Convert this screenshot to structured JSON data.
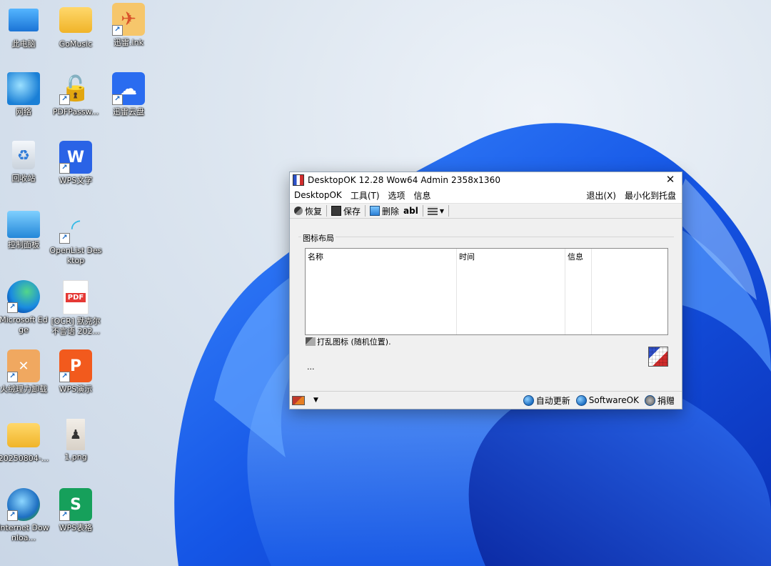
{
  "desktop": {
    "icons": [
      {
        "label": "此电脑",
        "name": "this-pc"
      },
      {
        "label": "GoMusic",
        "name": "gomusic"
      },
      {
        "label": "迅雷.lnk",
        "name": "xunlei-lnk"
      },
      {
        "label": "网络",
        "name": "network"
      },
      {
        "label": "PDFPassw...",
        "name": "pdfpassword"
      },
      {
        "label": "迅雷云盘",
        "name": "xunlei-cloud"
      },
      {
        "label": "回收站",
        "name": "recycle-bin"
      },
      {
        "label": "WPS文字",
        "name": "wps-writer"
      },
      {
        "label": "控制面板",
        "name": "control-panel"
      },
      {
        "label": "OpenList Desktop",
        "name": "openlist-desktop"
      },
      {
        "label": "Microsoft Edge",
        "name": "microsoft-edge"
      },
      {
        "label": "[OCR] 默克尔 不言语 202...",
        "name": "ocr-pdf"
      },
      {
        "label": "火绒理力卸载",
        "name": "uninstaller"
      },
      {
        "label": "WPS演示",
        "name": "wps-presentation"
      },
      {
        "label": "20250804-...",
        "name": "folder-20250804"
      },
      {
        "label": "1.png",
        "name": "png-file"
      },
      {
        "label": "Internet Downloa...",
        "name": "internet-download"
      },
      {
        "label": "WPS表格",
        "name": "wps-spreadsheet"
      }
    ]
  },
  "window": {
    "title": "DesktopOK 12.28   Wow64   Admin 2358x1360",
    "close": "✕",
    "menu": {
      "left": [
        "DesktopOK",
        "工具(T)",
        "选项",
        "信息"
      ],
      "right": [
        "退出(X)",
        "最小化到托盘"
      ]
    },
    "toolbar": {
      "restore": "恢复",
      "save": "保存",
      "delete": "删除",
      "abl": "abl"
    },
    "group_title": "图标布局",
    "columns": [
      "名称",
      "时间",
      "信息"
    ],
    "hint": "打乱图标 (随机位置).",
    "dots": "...",
    "status": {
      "auto_update": "自动更新",
      "softwareok": "SoftwareOK",
      "donate": "捐赠"
    }
  }
}
